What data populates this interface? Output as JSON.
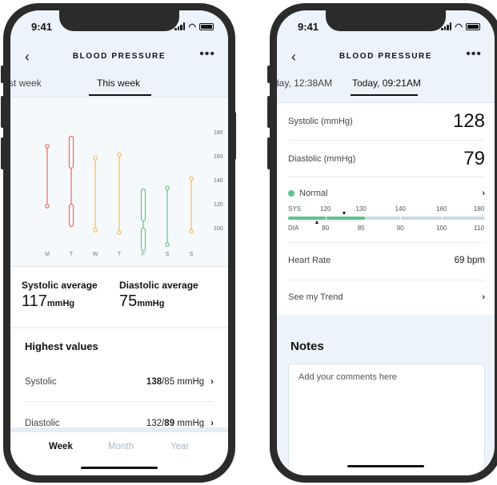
{
  "status_time": "9:41",
  "left": {
    "nav_title": "BLOOD PRESSURE",
    "tabs": [
      "st week",
      "This week"
    ],
    "chart_data": {
      "type": "range",
      "categories": [
        "M",
        "T",
        "W",
        "T",
        "F",
        "S",
        "S"
      ],
      "y_ticks": [
        180,
        160,
        140,
        120,
        100
      ],
      "ylim": [
        90,
        190
      ],
      "series": [
        {
          "systolic": 168,
          "diastolic": 118
        },
        {
          "systolic": 175,
          "diastolic": 101
        },
        {
          "systolic": 158,
          "diastolic": 98
        },
        {
          "systolic": 161,
          "diastolic": 96
        },
        {
          "systolic": 131,
          "diastolic": 81
        },
        {
          "systolic": 133,
          "diastolic": 86
        },
        {
          "systolic": 141,
          "diastolic": 97
        }
      ],
      "colors": [
        "#e8685a",
        "#e8685a",
        "#f2b857",
        "#f2b857",
        "#5cc48a",
        "#5cc48a",
        "#f2b857"
      ]
    },
    "averages": {
      "systolic_label": "Systolic average",
      "systolic_value": "117",
      "diastolic_label": "Diastolic average",
      "diastolic_value": "75",
      "unit": "mmHg"
    },
    "highest": {
      "title": "Highest values",
      "rows": [
        {
          "label": "Systolic",
          "bold": "138",
          "rest": "/85 mmHg"
        },
        {
          "label": "Diastolic",
          "pre": "132/",
          "bold": "89",
          "rest": " mmHg"
        }
      ]
    },
    "bottom_tabs": [
      "Week",
      "Month",
      "Year"
    ]
  },
  "right": {
    "nav_title": "BLOOD PRESSURE",
    "tabs": [
      "day, 12:38AM",
      "Today, 09:21AM"
    ],
    "systolic_label": "Systolic (mmHg)",
    "systolic_value": "128",
    "diastolic_label": "Diastolic (mmHg)",
    "diastolic_value": "79",
    "status": "Normal",
    "sys_label": "SYS",
    "dia_label": "DIA",
    "sys_scale": [
      "120",
      "130",
      "140",
      "160",
      "180"
    ],
    "dia_scale": [
      "80",
      "85",
      "90",
      "100",
      "110"
    ],
    "heart_rate_label": "Heart Rate",
    "heart_rate_value": "69 bpm",
    "trend_label": "See my Trend",
    "notes_title": "Notes",
    "notes_placeholder": "Add your comments here"
  }
}
